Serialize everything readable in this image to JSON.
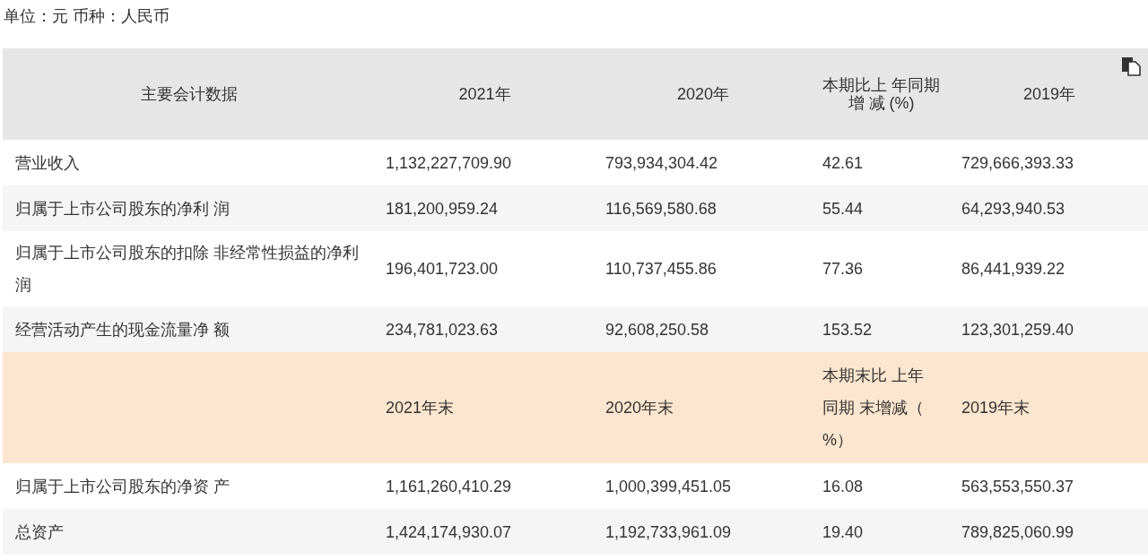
{
  "caption": "单位：元 币种：人民币",
  "table": {
    "columns": [
      "主要会计数据",
      "2021年",
      "2020年",
      "本期比上 年同期增 减 (%)",
      "2019年"
    ],
    "rows": [
      {
        "kind": "data",
        "cells": [
          "营业收入",
          "1,132,227,709.90",
          "793,934,304.42",
          "42.61",
          "729,666,393.33"
        ]
      },
      {
        "kind": "data",
        "cells": [
          "归属于上市公司股东的净利 润",
          "181,200,959.24",
          "116,569,580.68",
          "55.44",
          "64,293,940.53"
        ]
      },
      {
        "kind": "data",
        "cells": [
          "归属于上市公司股东的扣除 非经常性损益的净利润",
          "196,401,723.00",
          "110,737,455.86",
          "77.36",
          "86,441,939.22"
        ]
      },
      {
        "kind": "data",
        "cells": [
          "经营活动产生的现金流量净 额",
          "234,781,023.63",
          "92,608,250.58",
          "153.52",
          "123,301,259.40"
        ]
      },
      {
        "kind": "subheader",
        "cells": [
          "",
          "2021年末",
          "2020年末",
          "本期末比 上年同期 末增减（ %）",
          "2019年末"
        ]
      },
      {
        "kind": "data",
        "cells": [
          "归属于上市公司股东的净资 产",
          "1,161,260,410.29",
          "1,000,399,451.05",
          "16.08",
          "563,553,550.37"
        ]
      },
      {
        "kind": "data",
        "cells": [
          "总资产",
          "1,424,174,930.07",
          "1,192,733,961.09",
          "19.40",
          "789,825,060.99"
        ]
      }
    ]
  }
}
